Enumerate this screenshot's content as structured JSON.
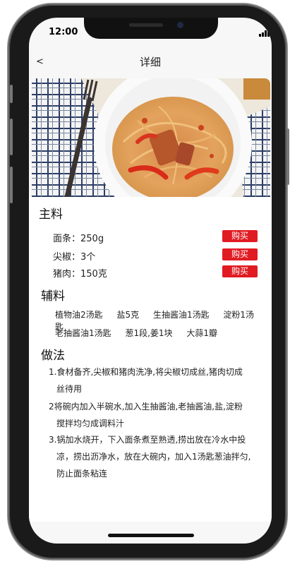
{
  "status": {
    "time": "12:00"
  },
  "nav": {
    "back": "<",
    "title": "详细"
  },
  "main_ingredients": {
    "title": "主料",
    "buy_label": "购买",
    "items": [
      {
        "name": "面条：250g"
      },
      {
        "name": "尖椒：3个"
      },
      {
        "name": "猪肉：150克"
      }
    ]
  },
  "aux_ingredients": {
    "title": "辅料",
    "lines": [
      [
        "植物油2汤匙",
        "盐5克",
        "生抽酱油1汤匙",
        "淀粉1汤匙"
      ],
      [
        "老抽酱油1汤匙",
        "葱1段,姜1块",
        "大蒜1瓣"
      ]
    ]
  },
  "method": {
    "title": "做法",
    "steps": [
      {
        "l1": "1.食材备齐,尖椒和猪肉洗净,将尖椒切成丝,猪肉切成",
        "l2": "丝待用"
      },
      {
        "l1": "2将碗内加入半碗水,加入生抽酱油,老抽酱油,盐,淀粉",
        "l2": "搅拌均匀成调料汁"
      },
      {
        "l1": "3.锅加水烧开，下入面条煮至熟透,捞出放在冷水中投",
        "l2": "凉，捞出沥净水，放在大碗内，加入1汤匙葱油拌匀,",
        "l3": "防止面条粘连"
      }
    ]
  },
  "colors": {
    "buy_button": "#e11b22",
    "device_frame": "#1a1a1a"
  }
}
